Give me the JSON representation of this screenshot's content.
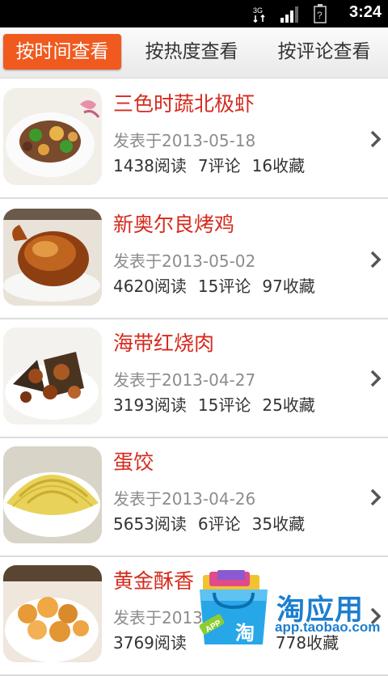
{
  "status_bar": {
    "time": "3:24",
    "network_label": "3G"
  },
  "tabs": [
    {
      "label": "按时间查看",
      "active": true
    },
    {
      "label": "按热度查看",
      "active": false
    },
    {
      "label": "按评论查看",
      "active": false
    }
  ],
  "colors": {
    "accent": "#f05a1e",
    "title": "#d62a1e",
    "watermark": "#1c7ed0"
  },
  "recipes": [
    {
      "title": "三色时蔬北极虾",
      "date": "发表于2013-05-18",
      "reads": "1438阅读",
      "comments": "7评论",
      "favorites": "16收藏",
      "image": "shrimp-vegetable-plate"
    },
    {
      "title": "新奥尔良烤鸡",
      "date": "发表于2013-05-02",
      "reads": "4620阅读",
      "comments": "15评论",
      "favorites": "97收藏",
      "image": "roast-chicken"
    },
    {
      "title": "海带红烧肉",
      "date": "发表于2013-04-27",
      "reads": "3193阅读",
      "comments": "15评论",
      "favorites": "25收藏",
      "image": "kelp-braised-pork"
    },
    {
      "title": "蛋饺",
      "date": "发表于2013-04-26",
      "reads": "5653阅读",
      "comments": "6评论",
      "favorites": "35收藏",
      "image": "egg-dumplings"
    },
    {
      "title": "黄金酥香",
      "date": "发表于2013",
      "reads": "3769阅读",
      "comments": "",
      "favorites": "778收藏",
      "image": "golden-crispy-fried"
    }
  ],
  "watermark": {
    "title": "淘应用",
    "url": "app.taobao.com",
    "bag_label": "APP",
    "bag_char": "淘"
  }
}
